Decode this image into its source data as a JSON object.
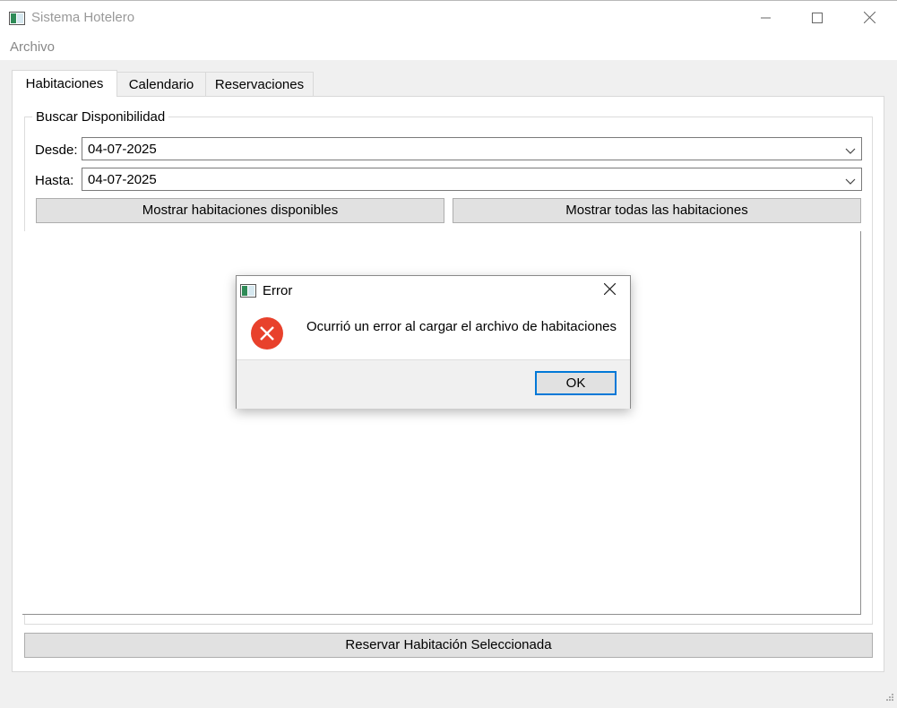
{
  "window": {
    "title": "Sistema Hotelero",
    "app_icon": "app-window-icon",
    "controls": [
      "minimize-icon",
      "maximize-icon",
      "close-icon"
    ]
  },
  "menubar": {
    "items": [
      {
        "label": "Archivo"
      }
    ]
  },
  "tabs": [
    {
      "label": "Habitaciones",
      "active": true
    },
    {
      "label": "Calendario",
      "active": false
    },
    {
      "label": "Reservaciones",
      "active": false
    }
  ],
  "search": {
    "group_title": "Buscar Disponibilidad",
    "from_label": "Desde:",
    "from_value": "04-07-2025",
    "to_label": "Hasta:",
    "to_value": "04-07-2025",
    "show_available_label": "Mostrar habitaciones disponibles",
    "show_all_label": "Mostrar todas las habitaciones"
  },
  "reserve_button_label": "Reservar Habitación Seleccionada",
  "dialog": {
    "title": "Error",
    "message": "Ocurrió un error al cargar el archivo de habitaciones",
    "ok_label": "OK",
    "icon": "error-icon"
  },
  "colors": {
    "error_red": "#e8412c",
    "focus_blue": "#0078d7"
  }
}
